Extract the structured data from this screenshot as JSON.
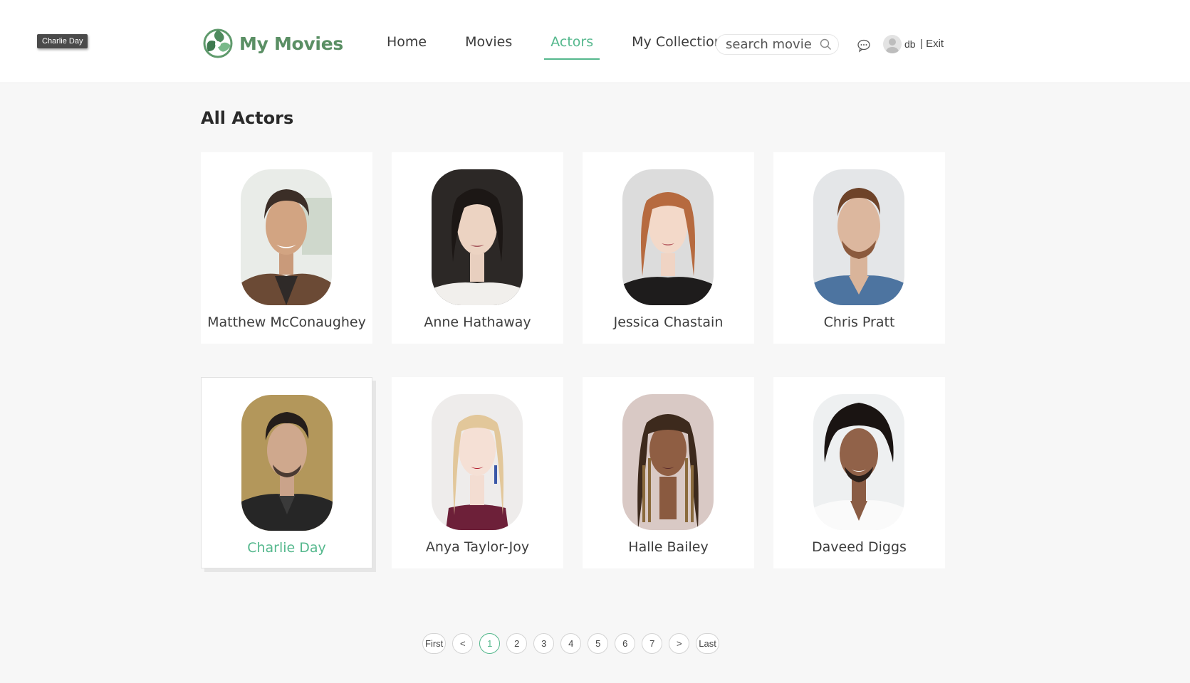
{
  "tooltip": "Charlie Day",
  "header": {
    "logo_text": "My Movies",
    "nav": [
      {
        "label": "Home",
        "active": false
      },
      {
        "label": "Movies",
        "active": false
      },
      {
        "label": "Actors",
        "active": true
      },
      {
        "label": "My Collections",
        "active": false
      }
    ],
    "search_placeholder": "search movie",
    "user_name": "db",
    "exit_label": "| Exit",
    "icons": [
      "logo-icon",
      "search-icon",
      "message-icon",
      "avatar-icon"
    ]
  },
  "page": {
    "title": "All Actors"
  },
  "actors": [
    {
      "name": "Matthew McConaughey"
    },
    {
      "name": "Anne Hathaway"
    },
    {
      "name": "Jessica Chastain"
    },
    {
      "name": "Chris Pratt"
    },
    {
      "name": "Charlie Day",
      "hovered": true
    },
    {
      "name": "Anya Taylor-Joy"
    },
    {
      "name": "Halle Bailey"
    },
    {
      "name": "Daveed Diggs"
    }
  ],
  "pagination": {
    "first": "First",
    "prev": "<",
    "pages": [
      "1",
      "2",
      "3",
      "4",
      "5",
      "6",
      "7"
    ],
    "current": "1",
    "next": ">",
    "last": "Last"
  },
  "colors": {
    "accent": "#55b88d",
    "logo": "#5a8f64",
    "background": "#f7f7f7"
  }
}
